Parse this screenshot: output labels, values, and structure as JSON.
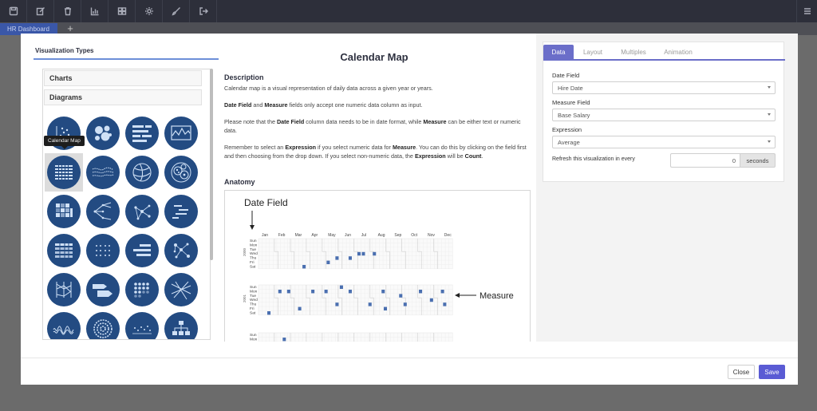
{
  "toolbar": {
    "icons": [
      "save-icon",
      "edit-icon",
      "trash-icon",
      "bar-chart-icon",
      "grid-icon",
      "gear-icon",
      "brush-icon",
      "sign-out-icon",
      "menu-icon"
    ]
  },
  "tabs": {
    "active_tab": "HR Dashboard",
    "add_label": "+"
  },
  "visualization_types": {
    "title": "Visualization Types",
    "categories": [
      "Charts",
      "Diagrams"
    ],
    "tooltip": "Calendar Map",
    "selected": "Calendar Map"
  },
  "description": {
    "title": "Calendar Map",
    "heading": "Description",
    "p1": "Calendar map is a visual representation of daily data across a given year or years.",
    "p2_b1": "Date Field",
    "p2_t1": " and ",
    "p2_b2": "Measure",
    "p2_t2": " fields only accept one numeric data column as input.",
    "p3_t1": "Please note that the ",
    "p3_b1": "Date Field",
    "p3_t2": " column data needs to be in date format, while ",
    "p3_b2": "Measure",
    "p3_t3": " can be either text or numeric data.",
    "p4_t1": "Remember to select an ",
    "p4_b1": "Expression",
    "p4_t2": " if you select numeric data for ",
    "p4_b2": "Measure",
    "p4_t3": ". You can do this by clicking on the field first and then choosing from the drop down. If you select non-numeric data, the ",
    "p4_b3": "Expression",
    "p4_t4": " will be ",
    "p4_b4": "Count",
    "p4_t5": ".",
    "anatomy_heading": "Anatomy",
    "anatomy": {
      "date_field_label": "Date Field",
      "measure_label": "Measure",
      "months": [
        "Jan",
        "Feb",
        "Mar",
        "Apr",
        "May",
        "Jun",
        "Jul",
        "Aug",
        "Sep",
        "Oct",
        "Nov",
        "Dec"
      ],
      "days": [
        "Sun",
        "Mon",
        "Tue",
        "Wed",
        "Thu",
        "Fri",
        "Sat"
      ],
      "years": [
        "2000",
        "2001"
      ]
    }
  },
  "settings": {
    "tabs": [
      "Data",
      "Layout",
      "Multiples",
      "Animation"
    ],
    "active_tab": "Data",
    "date_field_label": "Date Field",
    "date_field_value": "Hire Date",
    "measure_field_label": "Measure Field",
    "measure_field_value": "Base Salary",
    "expression_label": "Expression",
    "expression_value": "Average",
    "refresh_label": "Refresh this visualization in every",
    "refresh_value": "0",
    "refresh_unit": "seconds"
  },
  "footer": {
    "close_label": "Close",
    "save_label": "Save"
  },
  "colors": {
    "toolbar": "#2d2f3a",
    "accent": "#6b6ec9",
    "icon_circle": "#234b82",
    "save_button": "#5a5bd4"
  }
}
